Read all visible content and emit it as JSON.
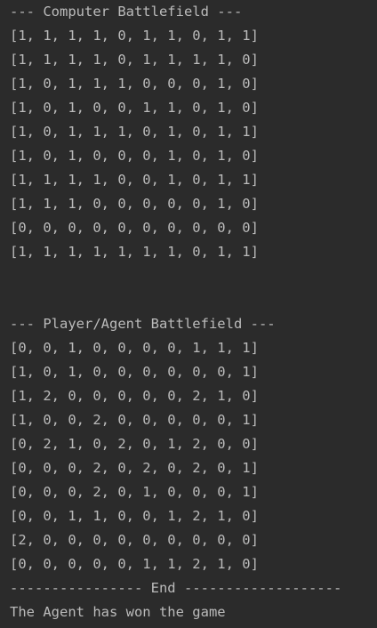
{
  "computer_header": "--- Computer Battlefield ---",
  "computer_rows": [
    "[1, 1, 1, 1, 0, 1, 1, 0, 1, 1]",
    "[1, 1, 1, 1, 0, 1, 1, 1, 1, 0]",
    "[1, 0, 1, 1, 1, 0, 0, 0, 1, 0]",
    "[1, 0, 1, 0, 0, 1, 1, 0, 1, 0]",
    "[1, 0, 1, 1, 1, 0, 1, 0, 1, 1]",
    "[1, 0, 1, 0, 0, 0, 1, 0, 1, 0]",
    "[1, 1, 1, 1, 0, 0, 1, 0, 1, 1]",
    "[1, 1, 1, 0, 0, 0, 0, 0, 1, 0]",
    "[0, 0, 0, 0, 0, 0, 0, 0, 0, 0]",
    "[1, 1, 1, 1, 1, 1, 1, 0, 1, 1]"
  ],
  "player_header": "--- Player/Agent Battlefield ---",
  "player_rows": [
    "[0, 0, 1, 0, 0, 0, 0, 1, 1, 1]",
    "[1, 0, 1, 0, 0, 0, 0, 0, 0, 1]",
    "[1, 2, 0, 0, 0, 0, 0, 2, 1, 0]",
    "[1, 0, 0, 2, 0, 0, 0, 0, 0, 1]",
    "[0, 2, 1, 0, 2, 0, 1, 2, 0, 0]",
    "[0, 0, 0, 2, 0, 2, 0, 2, 0, 1]",
    "[0, 0, 0, 2, 0, 1, 0, 0, 0, 1]",
    "[0, 0, 1, 1, 0, 0, 1, 2, 1, 0]",
    "[2, 0, 0, 0, 0, 0, 0, 0, 0, 0]",
    "[0, 0, 0, 0, 0, 1, 1, 2, 1, 0]"
  ],
  "end_line": "---------------- End -------------------",
  "result_text": "The Agent has won the game"
}
